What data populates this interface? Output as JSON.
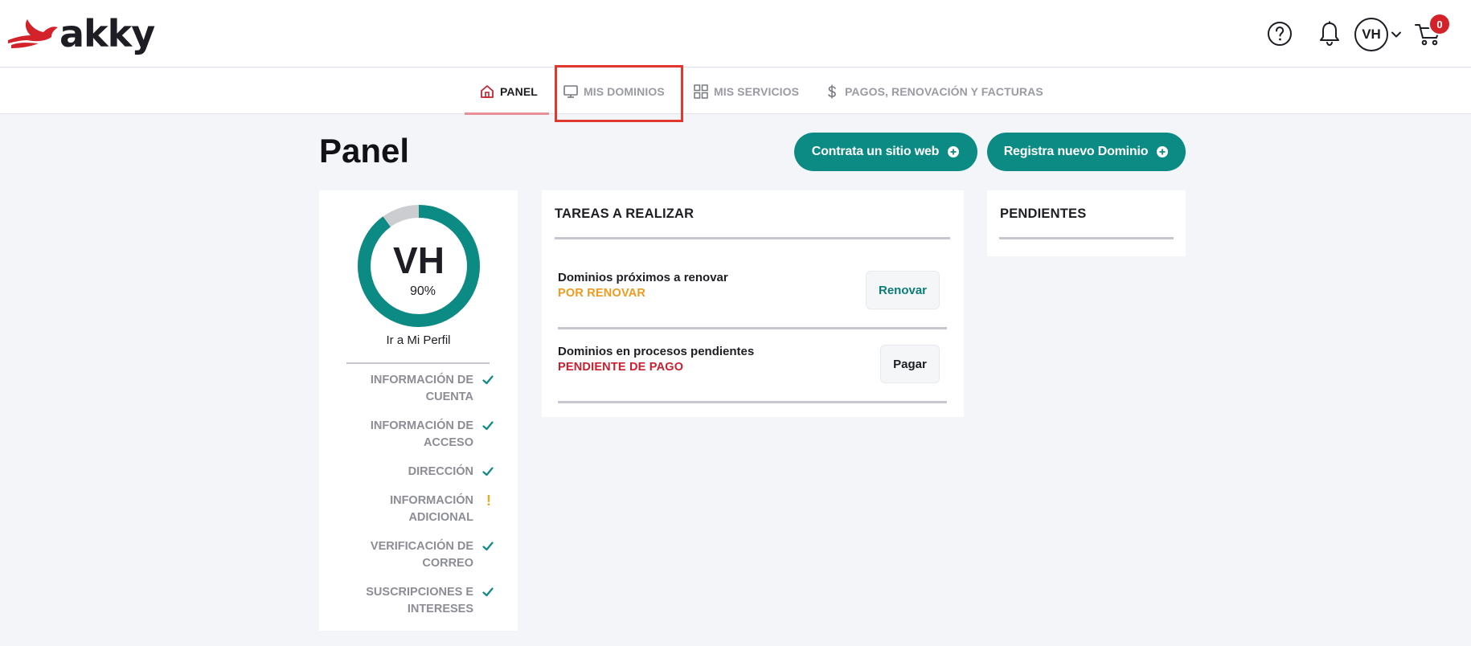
{
  "brand": {
    "logo_text": "akky"
  },
  "header": {
    "avatar_initials": "VH",
    "cart_count": "0"
  },
  "nav": {
    "tabs": [
      {
        "label": "PANEL",
        "icon": "home-icon"
      },
      {
        "label": "MIS DOMINIOS",
        "icon": "monitor-icon"
      },
      {
        "label": "MIS SERVICIOS",
        "icon": "grid-icon"
      },
      {
        "label": "PAGOS, RENOVACIÓN Y FACTURAS",
        "icon": "dollar-icon"
      }
    ]
  },
  "page": {
    "title": "Panel",
    "actions": {
      "web_label": "Contrata un sitio web",
      "domain_label": "Registra nuevo Dominio"
    }
  },
  "profile": {
    "initials": "VH",
    "completion": 90,
    "completion_label": "90%",
    "link_label": "Ir a Mi Perfil",
    "items": [
      {
        "line1": "INFORMACIÓN DE",
        "line2": "CUENTA",
        "status": "complete"
      },
      {
        "line1": "INFORMACIÓN DE",
        "line2": "ACCESO",
        "status": "complete"
      },
      {
        "line1": "DIRECCIÓN",
        "line2": "",
        "status": "complete"
      },
      {
        "line1": "INFORMACIÓN",
        "line2": "ADICIONAL",
        "status": "warning",
        "mark": "!"
      },
      {
        "line1": "VERIFICACIÓN DE",
        "line2": "CORREO",
        "status": "complete"
      },
      {
        "line1": "SUSCRIPCIONES E",
        "line2": "INTERESES",
        "status": "complete"
      }
    ]
  },
  "tasks": {
    "title": "TAREAS A REALIZAR",
    "items": [
      {
        "name": "Dominios próximos a renovar",
        "status": "POR RENOVAR",
        "status_color": "#ef9a1f",
        "action": "Renovar",
        "action_color": "#0b7d77"
      },
      {
        "name": "Dominios en procesos pendientes",
        "status": "PENDIENTE DE PAGO",
        "status_color": "#c8202f",
        "action": "Pagar",
        "action_color": "#1d1d23"
      }
    ]
  },
  "pending": {
    "title": "PENDIENTES"
  },
  "colors": {
    "accent": "#0b8b83",
    "brand_red": "#d3222a",
    "highlight": "#e0382e"
  }
}
